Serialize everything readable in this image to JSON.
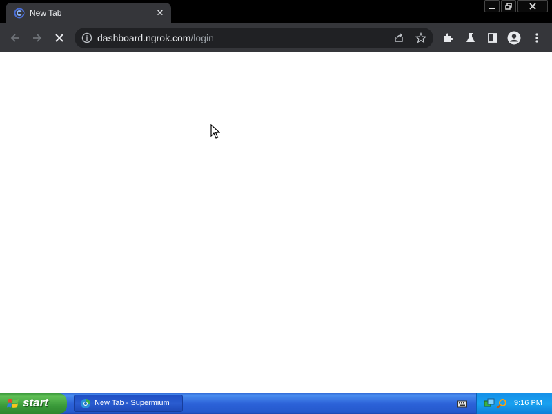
{
  "browser": {
    "tab": {
      "title": "New Tab"
    },
    "omnibox": {
      "url_host": "dashboard.ngrok.com",
      "url_path": "/login"
    }
  },
  "taskbar": {
    "start_label": "start",
    "task_button_label": "New Tab - Supermium",
    "clock": "9:16 PM"
  },
  "colors": {
    "tab_bg": "#35363a",
    "toolbar_bg": "#35363a",
    "omnibox_bg": "#202124",
    "page_bg": "#ffffff",
    "taskbar_blue": "#2c62d8",
    "start_green": "#3a9a3a"
  }
}
